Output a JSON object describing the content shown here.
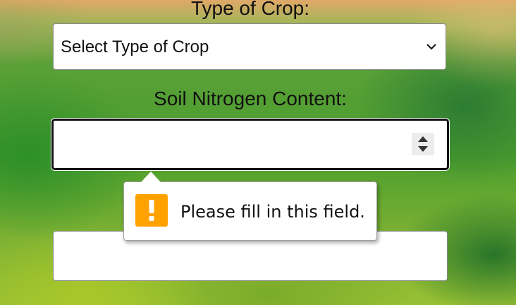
{
  "form": {
    "crop_type": {
      "label": "Type of Crop:",
      "selected_value": "Select Type of Crop",
      "icon": "chevron-down-icon"
    },
    "soil_nitrogen": {
      "label": "Soil Nitrogen Content:",
      "value": "",
      "spinner_icon": "up-down-arrows-icon"
    },
    "next_field": {
      "value": ""
    }
  },
  "validation_tooltip": {
    "message": "Please fill in this field.",
    "icon": "warning-exclamation-icon",
    "icon_color": "#FFA200"
  }
}
